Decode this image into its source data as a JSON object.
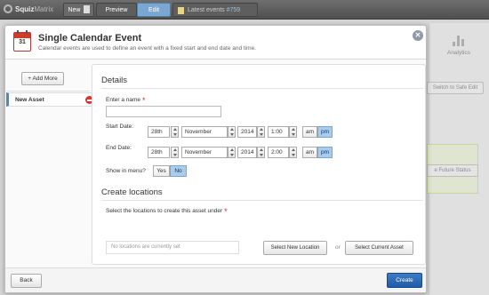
{
  "topbar": {
    "logo_brand": "Squiz",
    "logo_product": "Matrix",
    "new_label": "New",
    "preview_label": "Preview",
    "edit_label": "Edit",
    "events_label": "Latest events",
    "events_count": "#759"
  },
  "background": {
    "analytics_label": "Analytics",
    "safe_edit_label": "Switch to Safe Edit",
    "future_status_label": "e Future Status"
  },
  "dialog": {
    "icon_day": "31",
    "title": "Single Calendar Event",
    "subtitle": "Calendar events are used to define an event with a fixed start and end date and time.",
    "close_glyph": "✕"
  },
  "sidebar": {
    "add_more_label": "+ Add More",
    "items": [
      {
        "label": "New Asset"
      }
    ]
  },
  "details": {
    "heading": "Details",
    "name_label": "Enter a name",
    "name_value": "",
    "required_mark": "*",
    "start_label": "Start Date:",
    "start": {
      "day": "28th",
      "month": "November",
      "year": "2014",
      "time": "1:00",
      "am": "am",
      "pm": "pm",
      "selected": "pm"
    },
    "end_label": "End Date:",
    "end": {
      "day": "28th",
      "month": "November",
      "year": "2014",
      "time": "2:00",
      "am": "am",
      "pm": "pm",
      "selected": "pm"
    },
    "show_menu_label": "Show in menu?",
    "yes_label": "Yes",
    "no_label": "No",
    "show_menu_selected": "No"
  },
  "locations": {
    "heading": "Create locations",
    "select_label": "Select the locations to create this asset under",
    "empty_text": "No locations are currently set",
    "select_new_label": "Select New Location",
    "or_label": "or",
    "select_current_label": "Select Current Asset"
  },
  "footer": {
    "back_label": "Back",
    "create_label": "Create"
  },
  "colors": {
    "accent": "#1f5ca8",
    "selected_toggle": "#a9cdf0",
    "required": "#dd2222"
  }
}
